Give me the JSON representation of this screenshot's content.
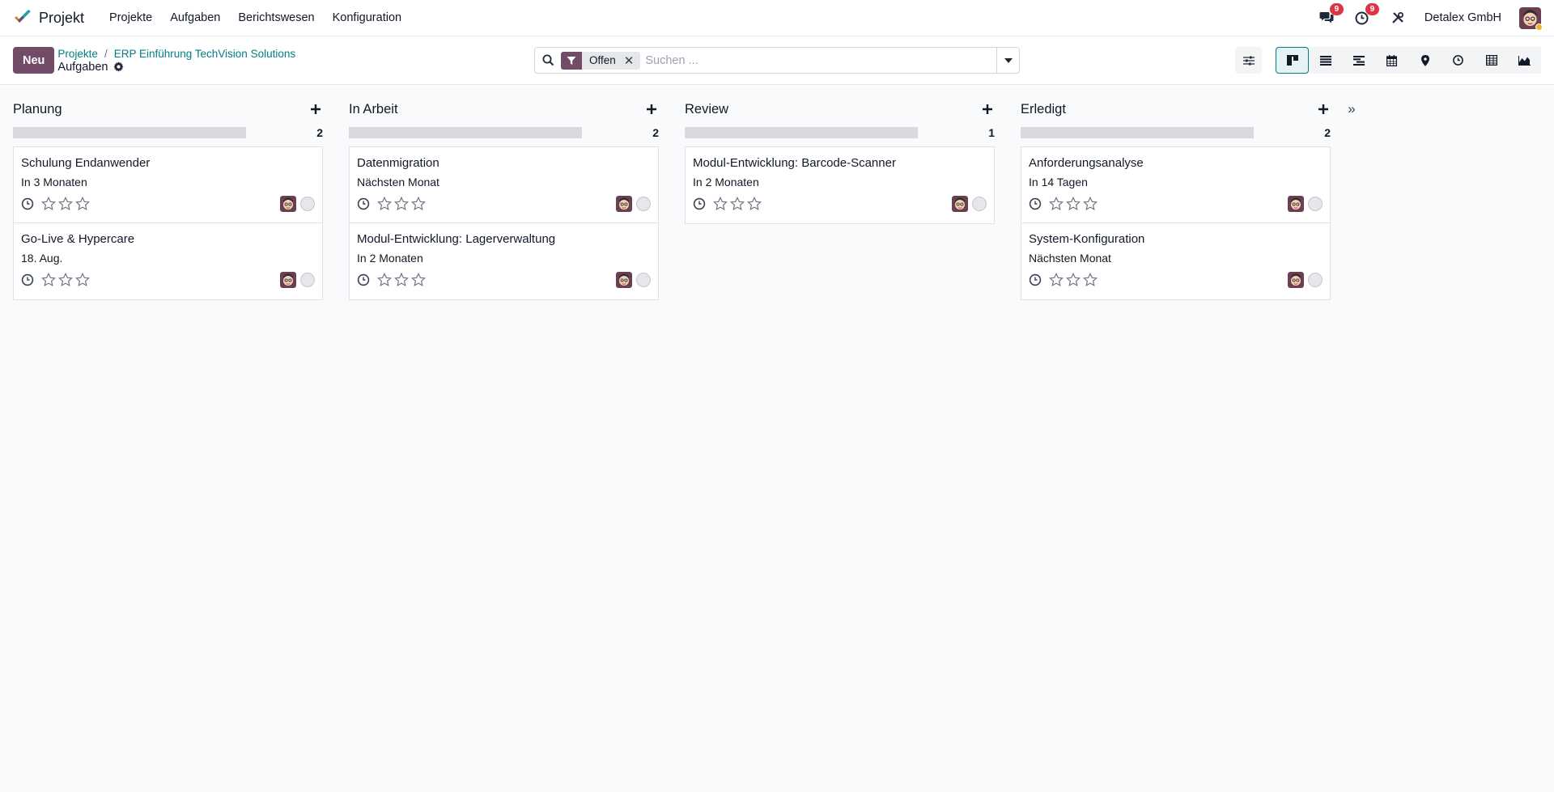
{
  "navbar": {
    "app_name": "Projekt",
    "menu": [
      "Projekte",
      "Aufgaben",
      "Berichtswesen",
      "Konfiguration"
    ],
    "messages_count": "9",
    "activities_count": "9",
    "company": "Detalex GmbH"
  },
  "control": {
    "new_label": "Neu",
    "breadcrumb": [
      "Projekte",
      "ERP Einführung TechVision Solutions"
    ],
    "breadcrumb_sep": "/",
    "current": "Aufgaben",
    "facet_label": "Offen",
    "facet_close": "✕",
    "search_placeholder": "Suchen ...",
    "views": [
      "kanban",
      "list",
      "gantt",
      "calendar",
      "map",
      "activity",
      "pivot",
      "graph"
    ],
    "active_view": "kanban"
  },
  "colors": {
    "brand": "#714b67",
    "link": "#017e84",
    "badge": "#dc3545"
  },
  "kanban": {
    "fold_icon": "»",
    "columns": [
      {
        "title": "Planung",
        "count": "2",
        "cards": [
          {
            "title": "Schulung Endanwender",
            "date": "In 3 Monaten"
          },
          {
            "title": "Go-Live & Hypercare",
            "date": "18. Aug."
          }
        ]
      },
      {
        "title": "In Arbeit",
        "count": "2",
        "cards": [
          {
            "title": "Datenmigration",
            "date": "Nächsten Monat"
          },
          {
            "title": "Modul-Entwicklung: Lagerverwaltung",
            "date": "In 2 Monaten"
          }
        ]
      },
      {
        "title": "Review",
        "count": "1",
        "cards": [
          {
            "title": "Modul-Entwicklung: Barcode-Scanner",
            "date": "In 2 Monaten"
          }
        ]
      },
      {
        "title": "Erledigt",
        "count": "2",
        "cards": [
          {
            "title": "Anforderungsanalyse",
            "date": "In 14 Tagen"
          },
          {
            "title": "System-Konfiguration",
            "date": "Nächsten Monat"
          }
        ]
      }
    ]
  }
}
